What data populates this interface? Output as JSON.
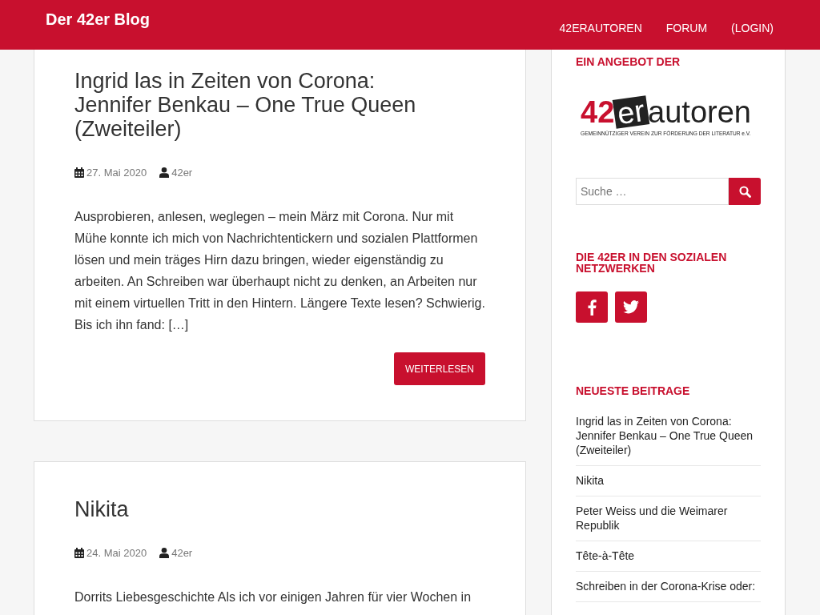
{
  "header": {
    "site_title": "Der 42er Blog",
    "nav": [
      {
        "label": "42ERAUTOREN"
      },
      {
        "label": "FORUM"
      },
      {
        "label": "(LOGIN)"
      }
    ]
  },
  "posts": [
    {
      "title": "Ingrid las in Zeiten von Corona: Jennifer Benkau – One True Queen (Zweiteiler)",
      "date": "27. Mai 2020",
      "author": "42er",
      "excerpt": "Ausprobieren, anlesen, weglegen – mein März mit Corona. Nur mit Mühe konnte ich mich von Nachrichtentickern und sozialen Plattformen lösen und mein träges Hirn dazu bringen, wieder eigenständig zu arbeiten. An Schreiben war überhaupt nicht zu denken, an Arbeiten nur mit einem virtuellen Tritt in den Hintern. Längere Texte lesen? Schwierig. Bis ich ihn fand: […]",
      "button": "WEITERLESEN"
    },
    {
      "title": "Nikita",
      "date": "24. Mai 2020",
      "author": "42er",
      "excerpt": "Dorrits Liebesgeschichte Als ich vor einigen Jahren für vier Wochen in"
    }
  ],
  "sidebar": {
    "offer_heading": "EIN ANGEBOT DER",
    "logo": {
      "number": "42",
      "suffix": "er",
      "word": "autoren",
      "tagline": "GEMEINNÜTZIGER VEREIN ZUR FÖRDERUNG DER LITERATUR e.V."
    },
    "search": {
      "placeholder": "Suche …"
    },
    "social_heading": "DIE 42ER IN DEN SOZIALEN NETZWERKEN",
    "social": [
      {
        "kind": "facebook"
      },
      {
        "kind": "twitter"
      }
    ],
    "recent_heading": "NEUESTE BEITRAGE",
    "recent": [
      {
        "title": "Ingrid las in Zeiten von Corona: Jennifer Benkau – One True Queen (Zweiteiler)"
      },
      {
        "title": "Nikita"
      },
      {
        "title": "Peter Weiss und die Weimarer Republik"
      },
      {
        "title": "Tête-à-Tête"
      },
      {
        "title": "Schreiben in der Corona-Krise oder:"
      }
    ]
  }
}
